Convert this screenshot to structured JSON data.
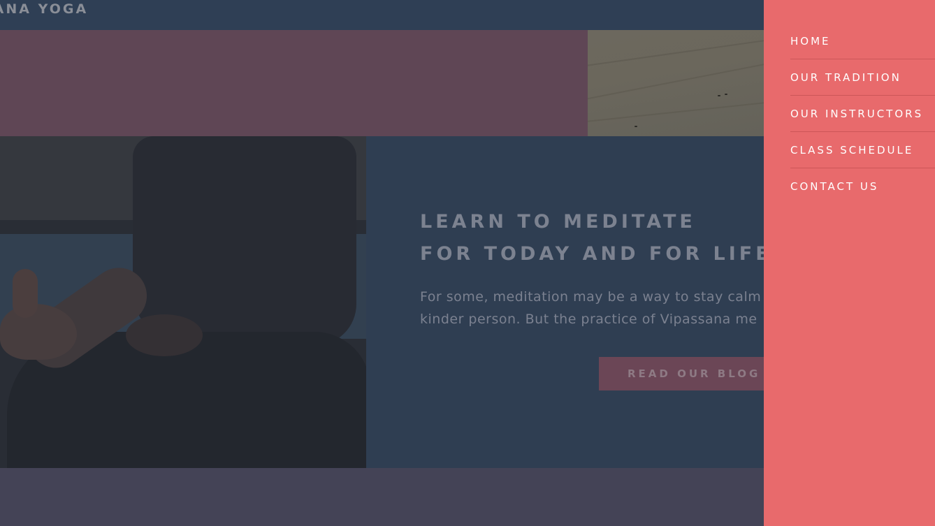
{
  "header": {
    "brand": "SANA YOGA"
  },
  "hero": {
    "headline_line1": "LEARN TO MEDITATE",
    "headline_line2": "FOR TODAY AND FOR LIFE",
    "body_line1": "For some, meditation may be a way to stay calm",
    "body_line2": "kinder person. But the practice of Vipassana me",
    "cta_label": "READ OUR BLOG"
  },
  "sidebar": {
    "items": [
      {
        "label": "HOME"
      },
      {
        "label": "OUR TRADITION"
      },
      {
        "label": "OUR INSTRUCTORS"
      },
      {
        "label": "CLASS SCHEDULE"
      },
      {
        "label": "CONTACT US"
      }
    ]
  },
  "colors": {
    "overlay_dark": "#2f3e52",
    "menu_background": "#e86a6c",
    "accent_band": "#5f4655",
    "button": "#6b4656",
    "bottom_strip": "#444356"
  }
}
